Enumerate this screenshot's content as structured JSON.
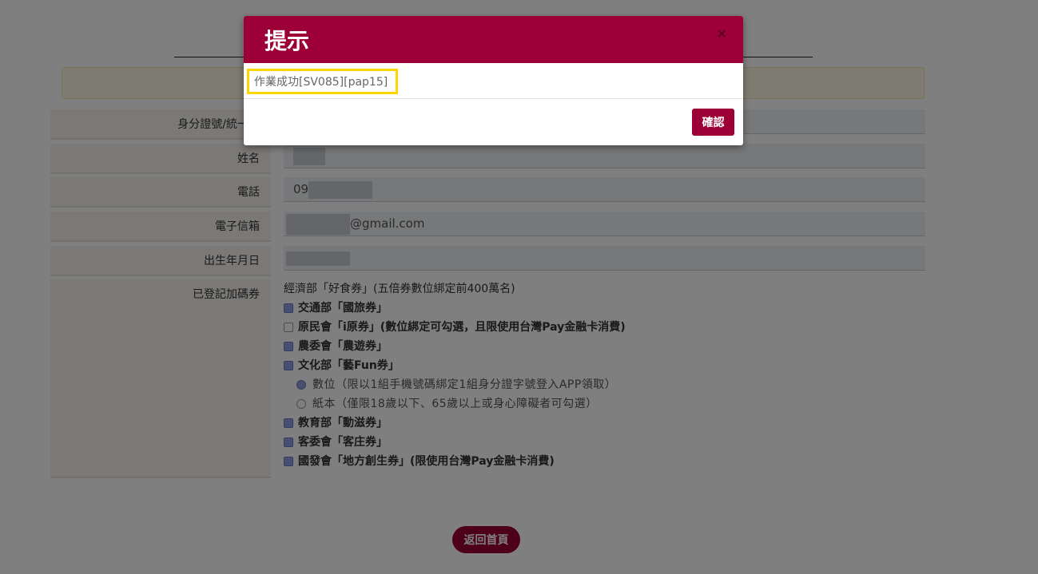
{
  "form": {
    "labels": {
      "id_number": "身分證號/統一證",
      "name": "姓名",
      "phone": "電話",
      "email": "電子信箱",
      "birthday": "出生年月日",
      "registered": "已登記加碼券"
    },
    "values": {
      "phone_prefix": "09",
      "email_suffix": "@gmail.com"
    }
  },
  "vouchers": {
    "heading": "經濟部「好食券」(五倍券數位綁定前400萬名)",
    "items": [
      {
        "label": "交通部「國旅券」",
        "checked": true
      },
      {
        "label": "原民會「i原券」(數位綁定可勾選，且限使用台灣Pay金融卡消費)",
        "checked": false
      },
      {
        "label": "農委會「農遊券」",
        "checked": true
      },
      {
        "label": "文化部「藝Fun券」",
        "checked": true
      },
      {
        "label": "教育部「動滋券」",
        "checked": true
      },
      {
        "label": "客委會「客庄券」",
        "checked": true
      },
      {
        "label": "國發會「地方創生券」(限使用台灣Pay金融卡消費)",
        "checked": true
      }
    ],
    "fun_options": [
      {
        "label": "數位（限以1組手機號碼綁定1組身分證字號登入APP領取）",
        "selected": true
      },
      {
        "label": "紙本（僅限18歲以下、65歲以上或身心障礙者可勾選）",
        "selected": false
      }
    ]
  },
  "buttons": {
    "home": "返回首頁",
    "confirm": "確認",
    "close": "×"
  },
  "modal": {
    "title": "提示",
    "message": "作業成功[SV085][pap15]"
  },
  "colors": {
    "brand": "#9c0037",
    "highlight": "#ffd500"
  }
}
